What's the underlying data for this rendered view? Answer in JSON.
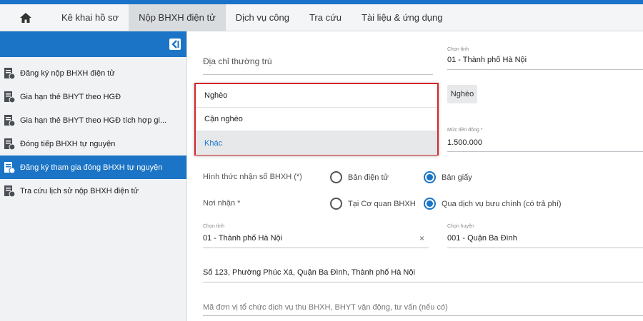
{
  "nav": {
    "items": [
      {
        "label": "Kê khai hồ sơ",
        "active": false
      },
      {
        "label": "Nộp BHXH điện tử",
        "active": true
      },
      {
        "label": "Dịch vụ công",
        "active": false
      },
      {
        "label": "Tra cứu",
        "active": false
      },
      {
        "label": "Tài liệu & ứng dụng",
        "active": false
      }
    ]
  },
  "sidebar": {
    "items": [
      {
        "label": "Đăng ký nộp BHXH điện tử",
        "active": false
      },
      {
        "label": "Gia hạn thẻ BHYT theo HGĐ",
        "active": false
      },
      {
        "label": "Gia hạn thẻ BHYT theo HGĐ tích hợp gi...",
        "active": false
      },
      {
        "label": "Đóng tiếp BHXH tự nguyện",
        "active": false
      },
      {
        "label": "Đăng ký tham gia đóng BHXH tự nguyện",
        "active": true
      },
      {
        "label": "Tra cứu lịch sử nộp BHXH điện tử",
        "active": false
      }
    ]
  },
  "form": {
    "address_label": "Địa chỉ thường trú",
    "province_small_label": "Chọn tỉnh",
    "province_value": "01 - Thành phố Hà Nội",
    "poverty_chip": "Nghèo",
    "amount_small_label": "Mức tiền đóng *",
    "amount_value": "1.500.000",
    "receive_form_label": "Hình thức nhận sổ BHXH (*)",
    "receive_form_options": [
      "Bản điện tử",
      "Bản giấy"
    ],
    "receive_form_selected": 1,
    "receive_place_label": "Nơi nhận *",
    "receive_place_options": [
      "Tại Cơ quan BHXH",
      "Qua dịch vụ bưu chính (có trả phí)"
    ],
    "receive_place_selected": 1,
    "mail_province_small_label": "Chọn tỉnh",
    "mail_province_value": "01 - Thành phố Hà Nội",
    "mail_district_small_label": "Chọn huyện",
    "mail_district_value": "001 - Quận Ba Đình",
    "clear_symbol": "×",
    "street_address": "Số 123, Phường Phúc Xá, Quận Ba Đình, Thành phố Hà Nội",
    "agency_placeholder": "Mã đơn vị tổ chức dịch vụ thu BHXH, BHYT vận động, tư vấn (nếu có)"
  },
  "dropdown": {
    "options": [
      "Nghèo",
      "Cận nghèo",
      "Khác"
    ],
    "highlighted": 2
  },
  "colors": {
    "primary": "#1b74c5",
    "dropdown_border": "#d5262a"
  }
}
